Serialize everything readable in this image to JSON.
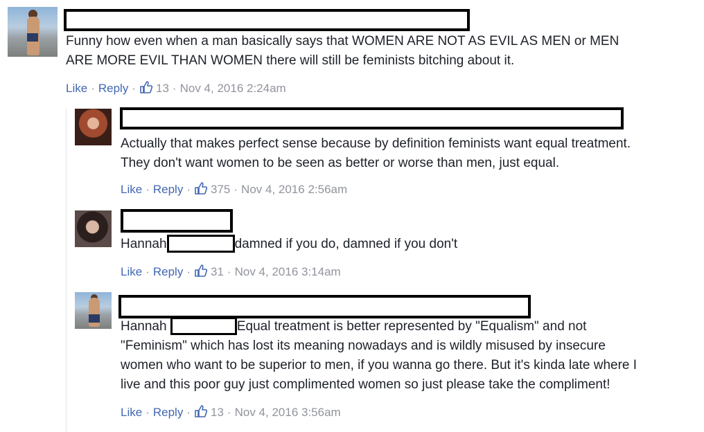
{
  "comments": [
    {
      "author_redacted": true,
      "text_lines": [
        "Funny how even when a man basically says that WOMEN ARE NOT AS EVIL AS MEN or MEN",
        "ARE MORE EVIL THAN WOMEN there will still be feminists bitching about it."
      ],
      "like": "Like",
      "reply": "Reply",
      "likes": "13",
      "time": "Nov 4, 2016 2:24am"
    },
    {
      "author_redacted": true,
      "text_lines": [
        "Actually that makes perfect sense because by definition feminists want equal treatment.",
        "They don't want women to be seen as better or worse than men, just equal."
      ],
      "like": "Like",
      "reply": "Reply",
      "likes": "375",
      "time": "Nov 4, 2016 2:56am"
    },
    {
      "author_redacted": true,
      "mention": "Hannah",
      "text_after_mention": "damned if you do, damned if you don't",
      "like": "Like",
      "reply": "Reply",
      "likes": "31",
      "time": "Nov 4, 2016 3:14am"
    },
    {
      "author_redacted": true,
      "mention": "Hannah",
      "text_after_mention": "Equal treatment is better represented by \"Equalism\" and not",
      "text_lines": [
        "\"Feminism\" which has lost its meaning nowadays and is wildly misused by insecure",
        "women who want to be superior to men, if you wanna go there. But it's kinda late where I",
        "live and this poor guy just complimented women so just please take the compliment!"
      ],
      "like": "Like",
      "reply": "Reply",
      "likes": "13",
      "time": "Nov 4, 2016 3:56am"
    }
  ],
  "separator": "·",
  "colors": {
    "link": "#4267b2",
    "meta": "#90949c",
    "text": "#1d2129"
  }
}
